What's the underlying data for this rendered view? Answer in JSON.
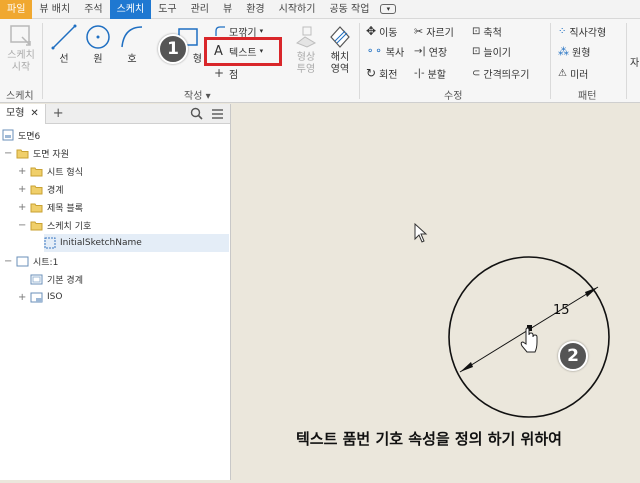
{
  "ribbon_tabs": [
    "파일",
    "뷰 배치",
    "주석",
    "스케치",
    "도구",
    "관리",
    "뷰",
    "환경",
    "시작하기",
    "공동 작업"
  ],
  "ribbon_more": "▾",
  "sketch_group": {
    "start_sketch": [
      "스케치",
      "시작"
    ],
    "label": "스케치"
  },
  "create_group": {
    "line": "선",
    "circle": "원",
    "arc": "호",
    "rect_partial": "형",
    "fillet": "모깎기",
    "text": "텍스트",
    "point": "점",
    "project": [
      "형상",
      "투영"
    ],
    "hatch": [
      "해치",
      "영역"
    ],
    "label": "작성"
  },
  "modify_group": {
    "move": "이동",
    "copy": "복사",
    "rotate": "회전",
    "trim": "자르기",
    "extend": "연장",
    "split": "분할",
    "scale": "축척",
    "stretch": "늘이기",
    "offset": "간격띄우기",
    "label": "수정"
  },
  "pattern_group": {
    "rect": "직사각형",
    "circ": "원형",
    "mirror": "미러",
    "label": "패턴"
  },
  "edge_char": "자",
  "browser": {
    "tab": "모형",
    "close": "✕",
    "add": "+",
    "tree": [
      {
        "label": "도면6",
        "pm": ""
      },
      {
        "label": "도면 자원",
        "pm": "−"
      },
      {
        "label": "시트 형식",
        "pm": "+"
      },
      {
        "label": "경계",
        "pm": "+"
      },
      {
        "label": "제목 블록",
        "pm": "+"
      },
      {
        "label": "스케치 기호",
        "pm": "−"
      },
      {
        "label": "InitialSketchName",
        "pm": ""
      },
      {
        "label": "시트:1",
        "pm": "−"
      },
      {
        "label": "기본 경계",
        "pm": ""
      },
      {
        "label": "ISO",
        "pm": "+"
      }
    ]
  },
  "canvas": {
    "dimension": "15"
  },
  "callouts": {
    "one": "1",
    "two": "2"
  },
  "caption": "텍스트 품번 기호 속성을 정의 하기 위하여"
}
